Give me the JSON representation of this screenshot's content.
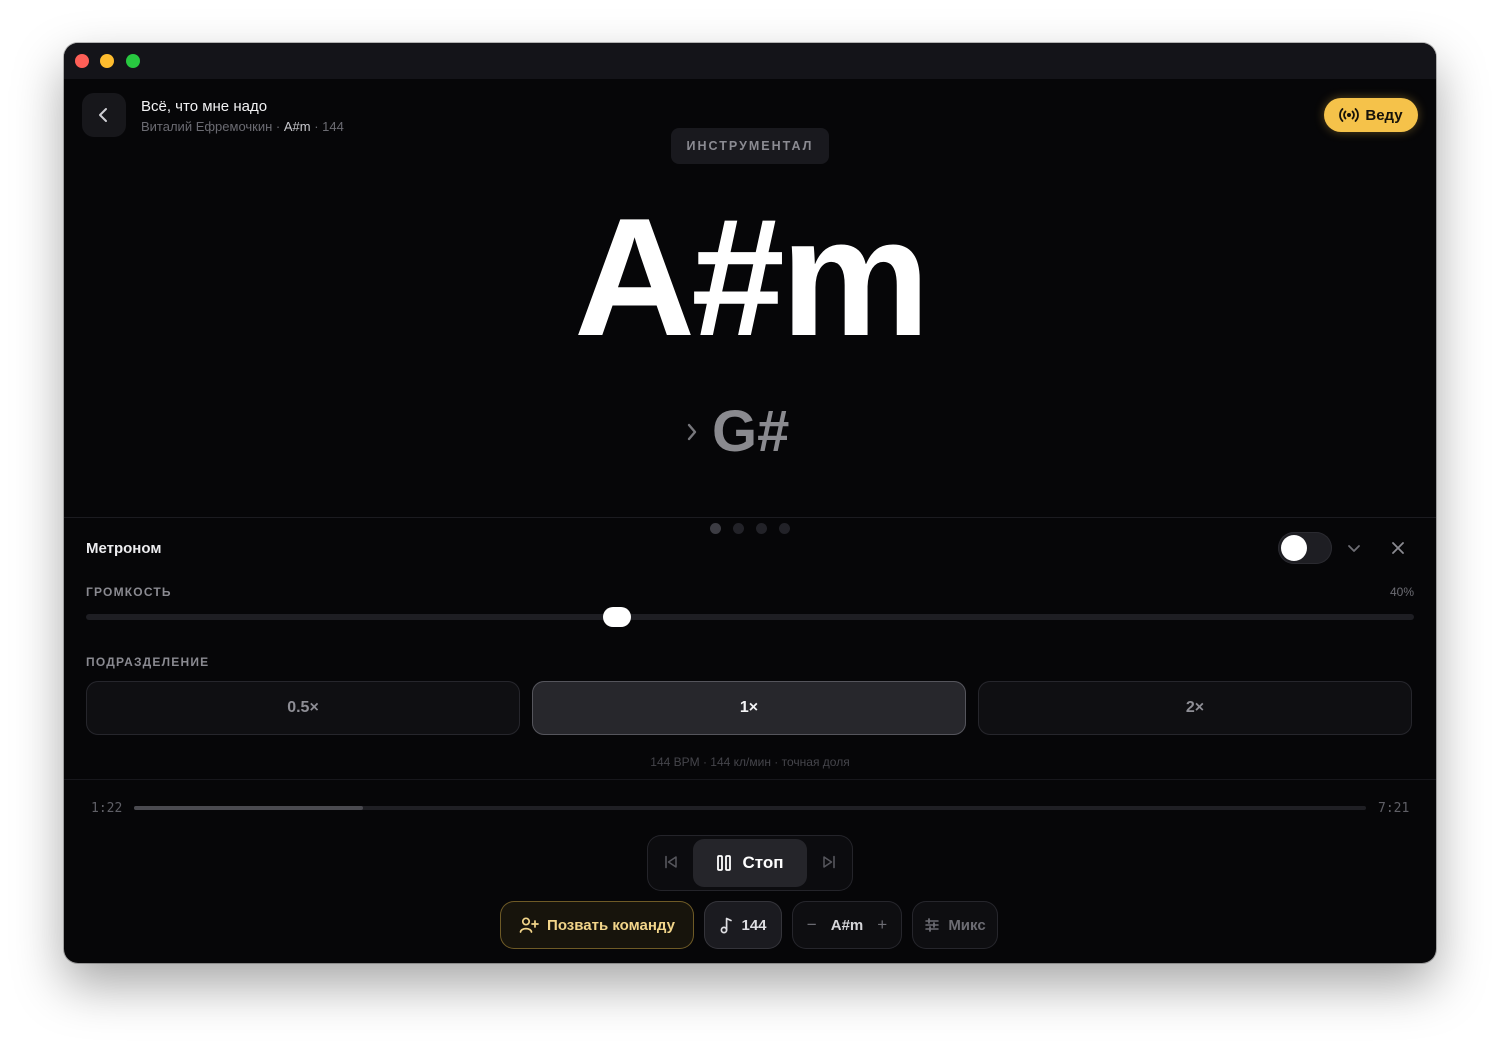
{
  "window": {
    "controls": [
      "close",
      "minimize",
      "maximize"
    ]
  },
  "header": {
    "back_icon": "chevron-left-icon",
    "song_title": "Всё, что мне надо",
    "artist": "Виталий Ефремочкин",
    "meta_sep1": " · ",
    "key": "A#m",
    "meta_sep2": " · ",
    "tempo": "144",
    "lead_button": {
      "label": "Веду",
      "icon": "broadcast-icon",
      "color": "#f5c24a"
    }
  },
  "stage": {
    "section": "ИНСТРУМЕНТАЛ",
    "current_chord": "A#m",
    "next_chord": "G#",
    "next_icon": "chevron-right-icon",
    "page_dots": {
      "count": 4,
      "active_index": 0
    }
  },
  "metronome": {
    "title": "Метроном",
    "enabled": false,
    "collapse_icon": "chevron-down-icon",
    "close_icon": "close-icon",
    "volume_label": "ГРОМКОСТЬ",
    "volume_value": "40%",
    "volume_fraction": 0.4,
    "subdivision_label": "ПОДРАЗДЕЛЕНИЕ",
    "subdivisions": [
      "0.5×",
      "1×",
      "2×"
    ],
    "selected_subdivision": "1×",
    "bpm_info": "144 BPM · 144 кл/мин · точная доля"
  },
  "playback": {
    "elapsed": "1:22",
    "total": "7:21",
    "progress_fraction": 0.186,
    "prev_icon": "skip-back-icon",
    "next_icon": "skip-forward-icon",
    "stop_label": "Стоп",
    "stop_icon": "pause-icon"
  },
  "toolbar": {
    "invite_label": "Позвать команду",
    "invite_icon": "user-plus-icon",
    "tempo_value": "144",
    "tempo_icon": "music-note-icon",
    "key_minus": "−",
    "key_value": "A#m",
    "key_plus": "+",
    "mix_label": "Микс",
    "mix_icon": "sliders-icon"
  }
}
